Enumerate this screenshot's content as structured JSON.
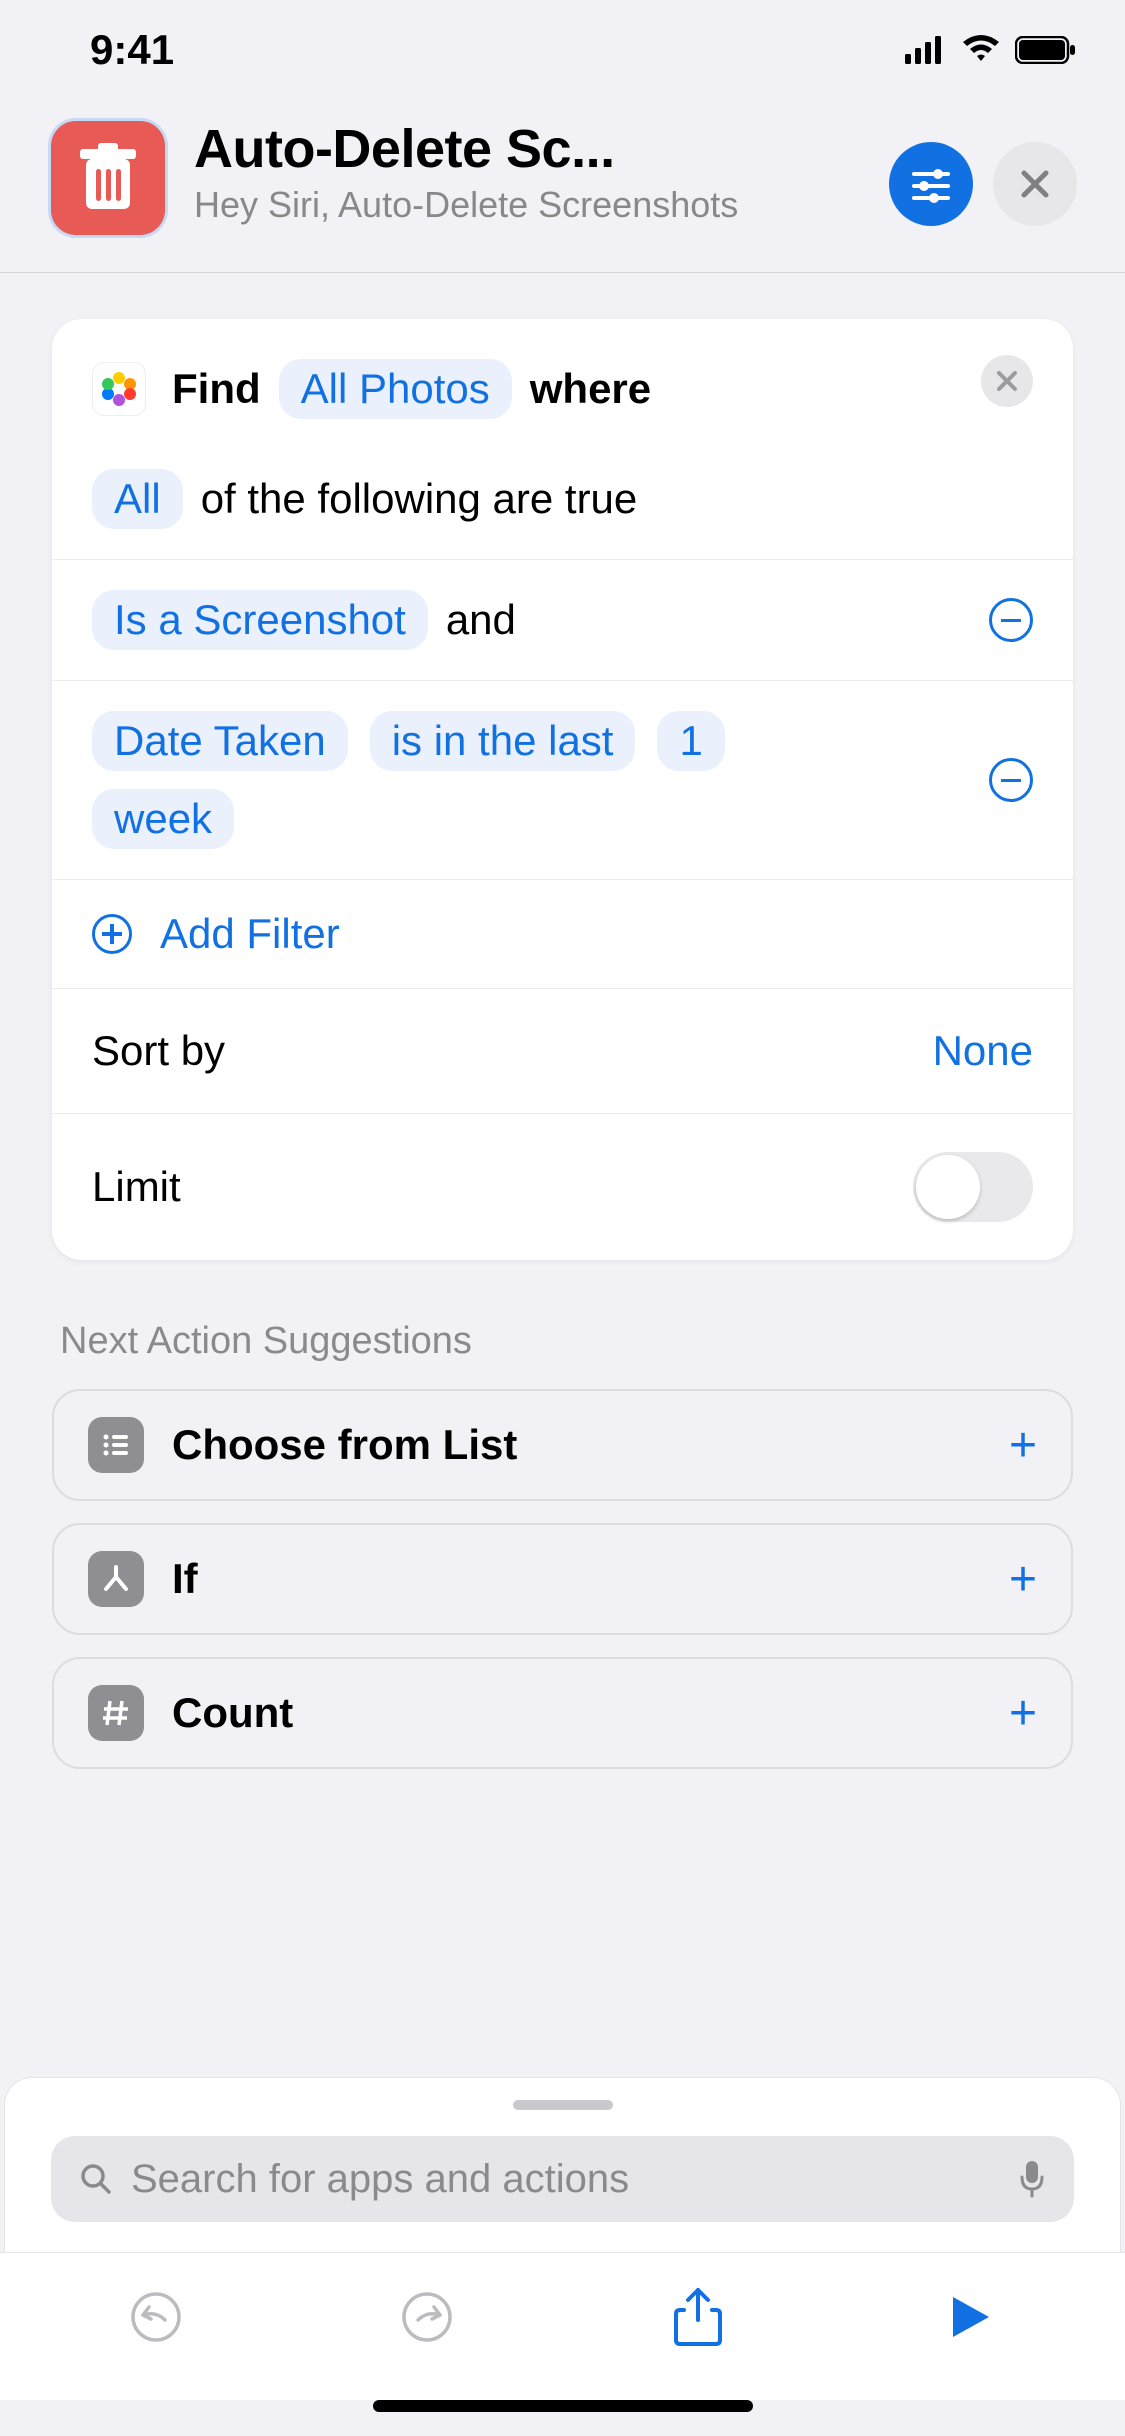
{
  "status": {
    "time": "9:41"
  },
  "header": {
    "title": "Auto-Delete Sc...",
    "subtitle": "Hey Siri, Auto-Delete Screenshots"
  },
  "action": {
    "find_label": "Find",
    "source_token": "All Photos",
    "where_label": "where",
    "scope_token": "All",
    "scope_suffix": "of the following are true",
    "conditions": [
      {
        "tokens": [
          "Is a Screenshot"
        ],
        "joiner": "and"
      },
      {
        "tokens": [
          "Date Taken",
          "is in the last",
          "1",
          "week"
        ],
        "joiner": ""
      }
    ],
    "add_filter_label": "Add Filter",
    "sort_label": "Sort by",
    "sort_value": "None",
    "limit_label": "Limit"
  },
  "suggestions": {
    "section_title": "Next Action Suggestions",
    "items": [
      {
        "label": "Choose from List",
        "icon": "list"
      },
      {
        "label": "If",
        "icon": "branch"
      },
      {
        "label": "Count",
        "icon": "hash"
      }
    ]
  },
  "search": {
    "placeholder": "Search for apps and actions"
  }
}
